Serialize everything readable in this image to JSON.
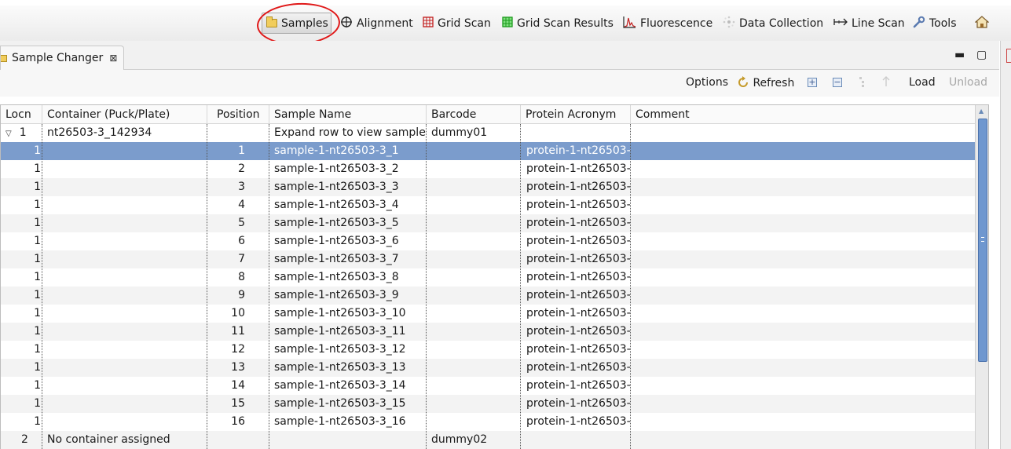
{
  "perspectives": [
    {
      "label": "Samples",
      "icon": "folder-icon",
      "active": true
    },
    {
      "label": "Alignment",
      "icon": "crosshair-icon"
    },
    {
      "label": "Grid Scan",
      "icon": "grid-icon"
    },
    {
      "label": "Grid Scan Results",
      "icon": "grid-results-icon"
    },
    {
      "label": "Fluorescence",
      "icon": "spectrum-icon"
    },
    {
      "label": "Data Collection",
      "icon": "data-collection-icon"
    },
    {
      "label": "Line Scan",
      "icon": "line-scan-icon"
    },
    {
      "label": "Tools",
      "icon": "wrench-icon"
    }
  ],
  "view_tab": {
    "title": "Sample Changer",
    "close": "⊠"
  },
  "window_controls": {
    "minimize": "▬",
    "maximize": "▢"
  },
  "toolbar": {
    "options": "Options",
    "refresh": "Refresh",
    "expand_all": "+",
    "collapse_all": "−",
    "load": "Load",
    "unload": "Unload"
  },
  "table": {
    "columns": [
      "Locn",
      "Container (Puck/Plate)",
      "Position",
      "Sample Name",
      "Barcode",
      "Protein Acronym",
      "Comment"
    ],
    "rows": [
      {
        "locn": "1",
        "container": "nt26503-3_142934",
        "position": "",
        "sample": "Expand row to view sample",
        "barcode": "dummy01",
        "protein": "",
        "comment": "",
        "expander": "▽"
      },
      {
        "locn": "1",
        "container": "",
        "position": "1",
        "sample": "sample-1-nt26503-3_1",
        "barcode": "",
        "protein": "protein-1-nt26503-",
        "comment": "",
        "selected": true
      },
      {
        "locn": "1",
        "container": "",
        "position": "2",
        "sample": "sample-1-nt26503-3_2",
        "barcode": "",
        "protein": "protein-1-nt26503-",
        "comment": ""
      },
      {
        "locn": "1",
        "container": "",
        "position": "3",
        "sample": "sample-1-nt26503-3_3",
        "barcode": "",
        "protein": "protein-1-nt26503-",
        "comment": ""
      },
      {
        "locn": "1",
        "container": "",
        "position": "4",
        "sample": "sample-1-nt26503-3_4",
        "barcode": "",
        "protein": "protein-1-nt26503-",
        "comment": ""
      },
      {
        "locn": "1",
        "container": "",
        "position": "5",
        "sample": "sample-1-nt26503-3_5",
        "barcode": "",
        "protein": "protein-1-nt26503-",
        "comment": ""
      },
      {
        "locn": "1",
        "container": "",
        "position": "6",
        "sample": "sample-1-nt26503-3_6",
        "barcode": "",
        "protein": "protein-1-nt26503-",
        "comment": ""
      },
      {
        "locn": "1",
        "container": "",
        "position": "7",
        "sample": "sample-1-nt26503-3_7",
        "barcode": "",
        "protein": "protein-1-nt26503-",
        "comment": ""
      },
      {
        "locn": "1",
        "container": "",
        "position": "8",
        "sample": "sample-1-nt26503-3_8",
        "barcode": "",
        "protein": "protein-1-nt26503-",
        "comment": ""
      },
      {
        "locn": "1",
        "container": "",
        "position": "9",
        "sample": "sample-1-nt26503-3_9",
        "barcode": "",
        "protein": "protein-1-nt26503-",
        "comment": ""
      },
      {
        "locn": "1",
        "container": "",
        "position": "10",
        "sample": "sample-1-nt26503-3_10",
        "barcode": "",
        "protein": "protein-1-nt26503-",
        "comment": ""
      },
      {
        "locn": "1",
        "container": "",
        "position": "11",
        "sample": "sample-1-nt26503-3_11",
        "barcode": "",
        "protein": "protein-1-nt26503-",
        "comment": ""
      },
      {
        "locn": "1",
        "container": "",
        "position": "12",
        "sample": "sample-1-nt26503-3_12",
        "barcode": "",
        "protein": "protein-1-nt26503-",
        "comment": ""
      },
      {
        "locn": "1",
        "container": "",
        "position": "13",
        "sample": "sample-1-nt26503-3_13",
        "barcode": "",
        "protein": "protein-1-nt26503-",
        "comment": ""
      },
      {
        "locn": "1",
        "container": "",
        "position": "14",
        "sample": "sample-1-nt26503-3_14",
        "barcode": "",
        "protein": "protein-1-nt26503-",
        "comment": ""
      },
      {
        "locn": "1",
        "container": "",
        "position": "15",
        "sample": "sample-1-nt26503-3_15",
        "barcode": "",
        "protein": "protein-1-nt26503-",
        "comment": ""
      },
      {
        "locn": "1",
        "container": "",
        "position": "16",
        "sample": "sample-1-nt26503-3_16",
        "barcode": "",
        "protein": "protein-1-nt26503-",
        "comment": ""
      },
      {
        "locn": "2",
        "container": "No container assigned",
        "position": "",
        "sample": "",
        "barcode": "dummy02",
        "protein": "",
        "comment": ""
      }
    ]
  },
  "colors": {
    "selection": "#7b9ccc",
    "highlight_circle": "#e01818",
    "scroll_thumb": "#6f97cf"
  }
}
